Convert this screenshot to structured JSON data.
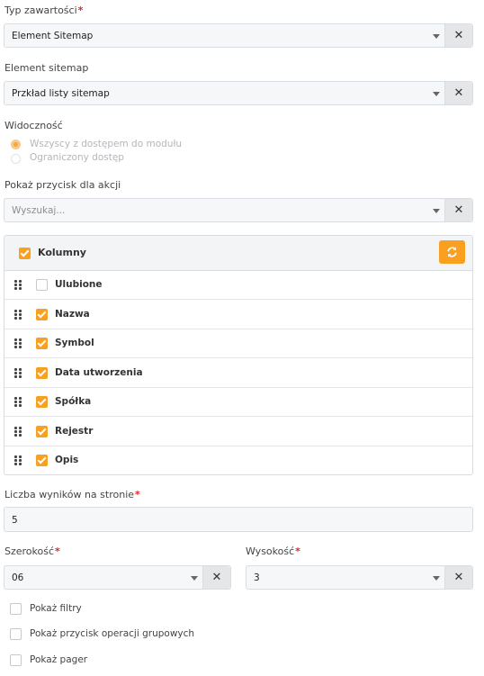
{
  "content_type": {
    "label": "Typ zawartości",
    "required": "*",
    "value": "Element Sitemap",
    "clear": "✕"
  },
  "element_sitemap": {
    "label": "Element sitemap",
    "value": "Przkład listy sitemap",
    "clear": "✕"
  },
  "visibility": {
    "label": "Widoczność",
    "options": [
      {
        "label": "Wszyscy z dostępem do modułu",
        "selected": true
      },
      {
        "label": "Ograniczony dostęp",
        "selected": false
      }
    ]
  },
  "action_button": {
    "label": "Pokaż przycisk dla akcji",
    "placeholder": "Wyszukaj...",
    "clear": "✕"
  },
  "columns": {
    "title": "Kolumny",
    "checked": true,
    "items": [
      {
        "label": "Ulubione",
        "checked": false
      },
      {
        "label": "Nazwa",
        "checked": true
      },
      {
        "label": "Symbol",
        "checked": true
      },
      {
        "label": "Data utworzenia",
        "checked": true
      },
      {
        "label": "Spółka",
        "checked": true
      },
      {
        "label": "Rejestr",
        "checked": true
      },
      {
        "label": "Opis",
        "checked": true
      }
    ]
  },
  "results_per_page": {
    "label": "Liczba wyników na stronie",
    "required": "*",
    "value": "5"
  },
  "width": {
    "label": "Szerokość",
    "required": "*",
    "value": "06",
    "clear": "✕"
  },
  "height": {
    "label": "Wysokość",
    "required": "*",
    "value": "3",
    "clear": "✕"
  },
  "options": [
    {
      "label": "Pokaż filtry",
      "checked": false
    },
    {
      "label": "Pokaż przycisk operacji grupowych",
      "checked": false
    },
    {
      "label": "Pokaż pager",
      "checked": false
    }
  ],
  "colors": {
    "accent": "#f9a020",
    "required": "#e0262b",
    "field_bg": "#f6f7f8",
    "border": "#d9dde1"
  }
}
